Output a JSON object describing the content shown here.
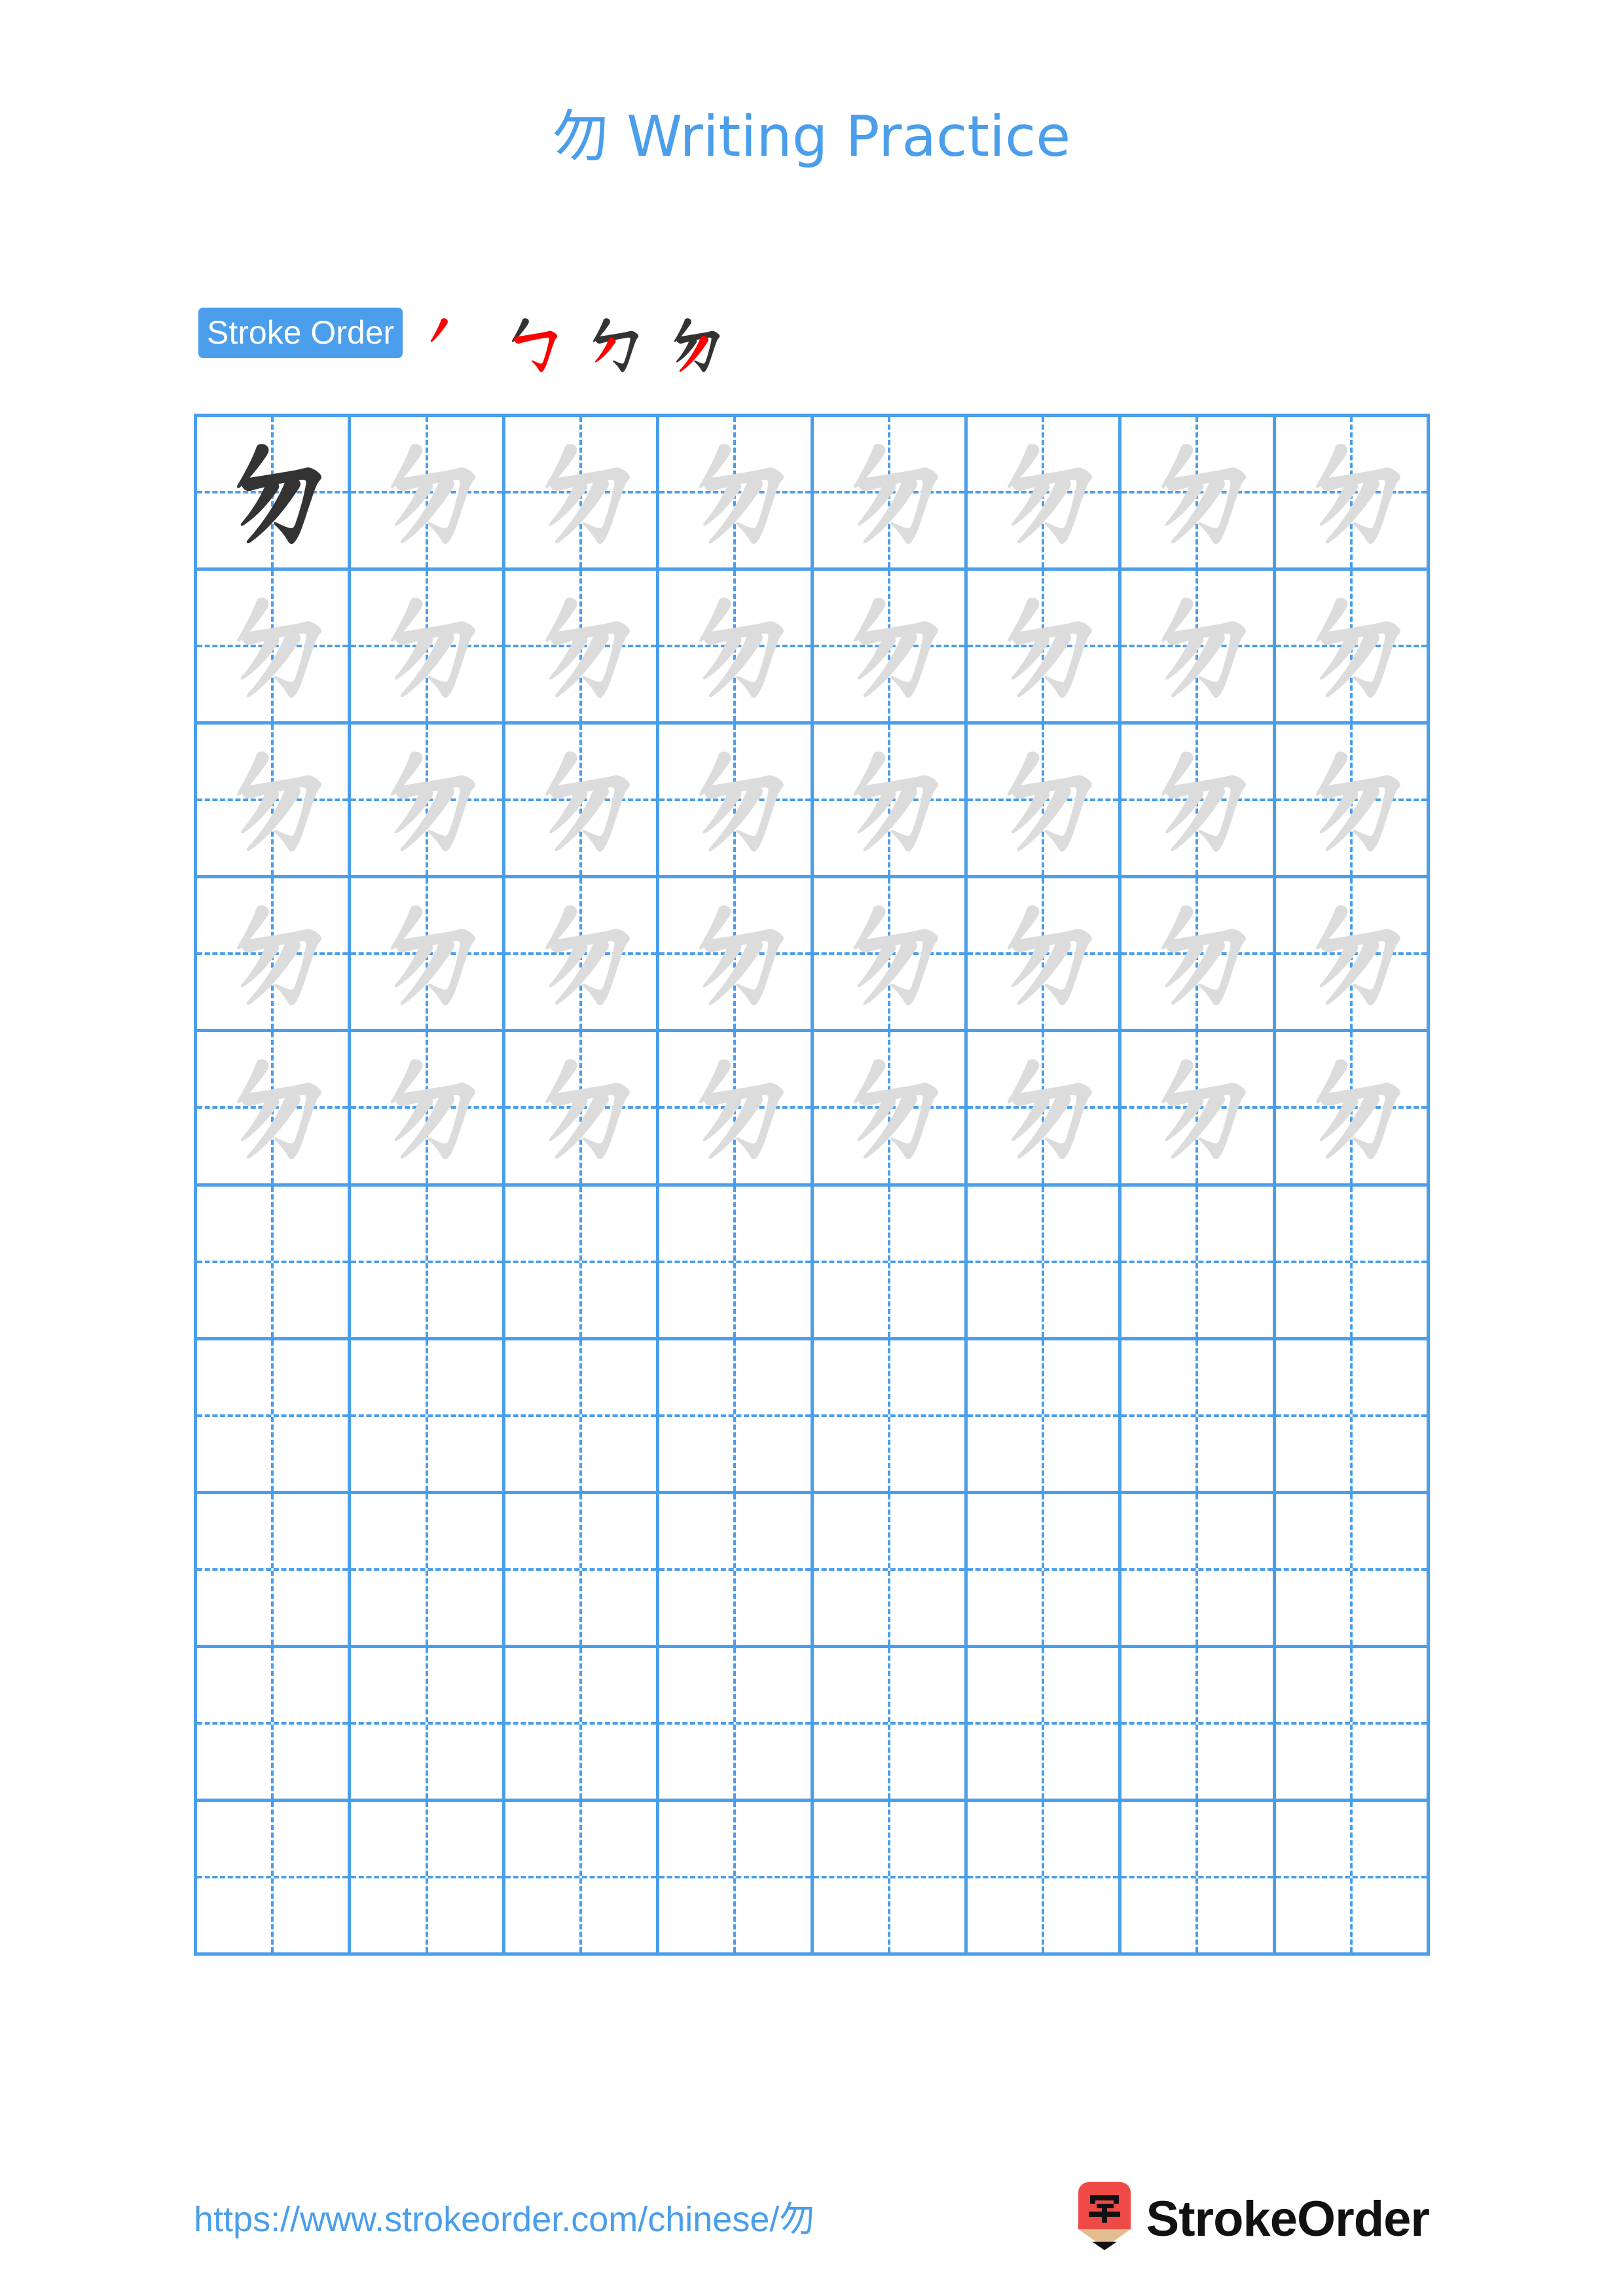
{
  "page": {
    "character": "勿",
    "title": "勿 Writing Practice",
    "title_suffix": " Writing Practice"
  },
  "stroke_order": {
    "label": "Stroke Order",
    "total_strokes": 4,
    "new_stroke_color": "#FF0000",
    "done_stroke_color": "#333333",
    "steps": [
      {
        "index": 1,
        "strokes_shown": 1,
        "new_stroke": 1,
        "name": "pie"
      },
      {
        "index": 2,
        "strokes_shown": 2,
        "new_stroke": 2,
        "name": "heng-zhe-gou"
      },
      {
        "index": 3,
        "strokes_shown": 3,
        "new_stroke": 3,
        "name": "pie-2"
      },
      {
        "index": 4,
        "strokes_shown": 4,
        "new_stroke": 4,
        "name": "pie-3"
      }
    ]
  },
  "grid": {
    "columns": 8,
    "rows": 10,
    "line_color": "#4a9eeb",
    "guide_style": "dashed-crosshair",
    "model_char_color": "#333333",
    "trace_char_color": "#dcdcdc",
    "cells": [
      [
        "model",
        "trace",
        "trace",
        "trace",
        "trace",
        "trace",
        "trace",
        "trace"
      ],
      [
        "trace",
        "trace",
        "trace",
        "trace",
        "trace",
        "trace",
        "trace",
        "trace"
      ],
      [
        "trace",
        "trace",
        "trace",
        "trace",
        "trace",
        "trace",
        "trace",
        "trace"
      ],
      [
        "trace",
        "trace",
        "trace",
        "trace",
        "trace",
        "trace",
        "trace",
        "trace"
      ],
      [
        "trace",
        "trace",
        "trace",
        "trace",
        "trace",
        "trace",
        "trace",
        "trace"
      ],
      [
        "empty",
        "empty",
        "empty",
        "empty",
        "empty",
        "empty",
        "empty",
        "empty"
      ],
      [
        "empty",
        "empty",
        "empty",
        "empty",
        "empty",
        "empty",
        "empty",
        "empty"
      ],
      [
        "empty",
        "empty",
        "empty",
        "empty",
        "empty",
        "empty",
        "empty",
        "empty"
      ],
      [
        "empty",
        "empty",
        "empty",
        "empty",
        "empty",
        "empty",
        "empty",
        "empty"
      ],
      [
        "empty",
        "empty",
        "empty",
        "empty",
        "empty",
        "empty",
        "empty",
        "empty"
      ]
    ]
  },
  "footer": {
    "url": "https://www.strokeorder.com/chinese/勿",
    "brand_name": "StrokeOrder",
    "logo": {
      "name": "pencil-logo",
      "glyph": "字",
      "body_color": "#ef4a46",
      "wood_color": "#e3bd8f",
      "tip_color": "#111111"
    }
  },
  "colors": {
    "accent_blue": "#4a9eeb",
    "ink_dark": "#333333",
    "trace_gray": "#dcdcdc",
    "stroke_red": "#FF0000"
  }
}
